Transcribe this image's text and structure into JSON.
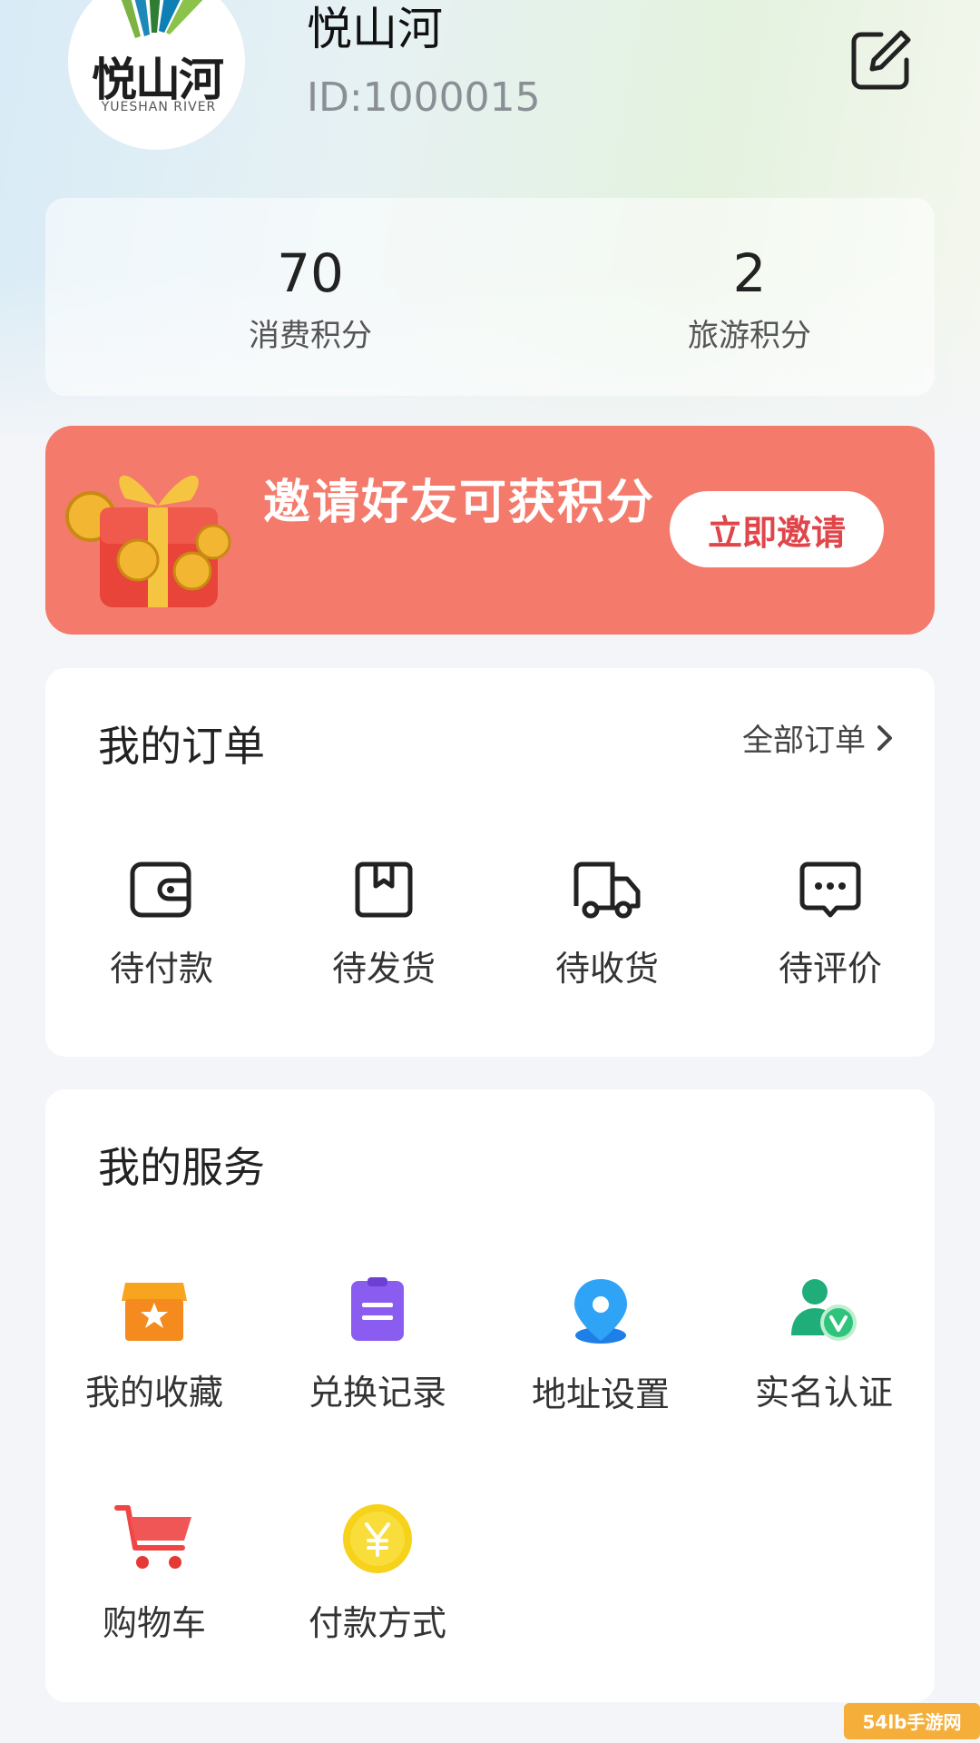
{
  "profile": {
    "name": "悦山河",
    "id": "ID:1000015",
    "logo_text": "悦山河",
    "logo_sub": "YUESHAN RIVER"
  },
  "icons": {
    "edit": "edit-icon"
  },
  "points": [
    {
      "value": "70",
      "label": "消费积分"
    },
    {
      "value": "2",
      "label": "旅游积分"
    }
  ],
  "invite": {
    "text": "邀请好友可获积分",
    "button": "立即邀请"
  },
  "orders": {
    "title": "我的订单",
    "all_label": "全部订单",
    "items": [
      {
        "label": "待付款",
        "icon": "wallet-icon"
      },
      {
        "label": "待发货",
        "icon": "box-icon"
      },
      {
        "label": "待收货",
        "icon": "truck-icon"
      },
      {
        "label": "待评价",
        "icon": "comment-icon"
      }
    ]
  },
  "services": {
    "title": "我的服务",
    "items": [
      {
        "label": "我的收藏",
        "icon": "favorite-box-icon"
      },
      {
        "label": "兑换记录",
        "icon": "record-icon"
      },
      {
        "label": "地址设置",
        "icon": "location-icon"
      },
      {
        "label": "实名认证",
        "icon": "verified-user-icon"
      },
      {
        "label": "购物车",
        "icon": "cart-icon"
      },
      {
        "label": "付款方式",
        "icon": "yen-coin-icon"
      }
    ]
  },
  "watermark": "54lb手游网",
  "colors": {
    "invite_bg": "#f47a6c",
    "invite_button_text": "#e0454a"
  }
}
